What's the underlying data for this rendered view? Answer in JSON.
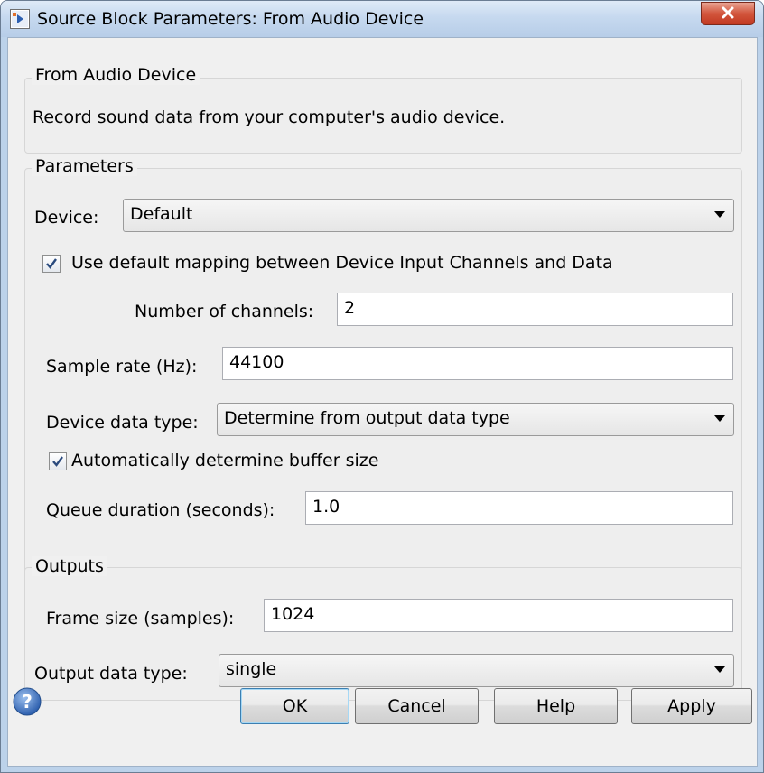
{
  "window": {
    "title": "Source Block Parameters: From Audio Device"
  },
  "description": {
    "group_title": "From Audio Device",
    "text": "Record sound data from your computer's audio device."
  },
  "parameters": {
    "group_title": "Parameters",
    "device_label": "Device:",
    "device_value": "Default",
    "default_mapping_label": "Use default mapping between Device Input Channels and Data",
    "default_mapping_checked": true,
    "num_channels_label": "Number of channels:",
    "num_channels_value": "2",
    "sample_rate_label": "Sample rate (Hz):",
    "sample_rate_value": "44100",
    "device_data_type_label": "Device data type:",
    "device_data_type_value": "Determine from output data type",
    "auto_buffer_label": "Automatically determine buffer size",
    "auto_buffer_checked": true,
    "queue_duration_label": "Queue duration (seconds):",
    "queue_duration_value": "1.0"
  },
  "outputs": {
    "group_title": "Outputs",
    "frame_size_label": "Frame size (samples):",
    "frame_size_value": "1024",
    "output_data_type_label": "Output data type:",
    "output_data_type_value": "single"
  },
  "buttons": {
    "ok": "OK",
    "cancel": "Cancel",
    "help": "Help",
    "apply": "Apply"
  },
  "icons": {
    "app": "simulink-block-icon",
    "close": "close-icon",
    "help": "help-question-icon"
  },
  "colors": {
    "title_bar": "#c6d9ef",
    "close_button": "#d2553c",
    "dialog_bg": "#f0f0f0"
  }
}
